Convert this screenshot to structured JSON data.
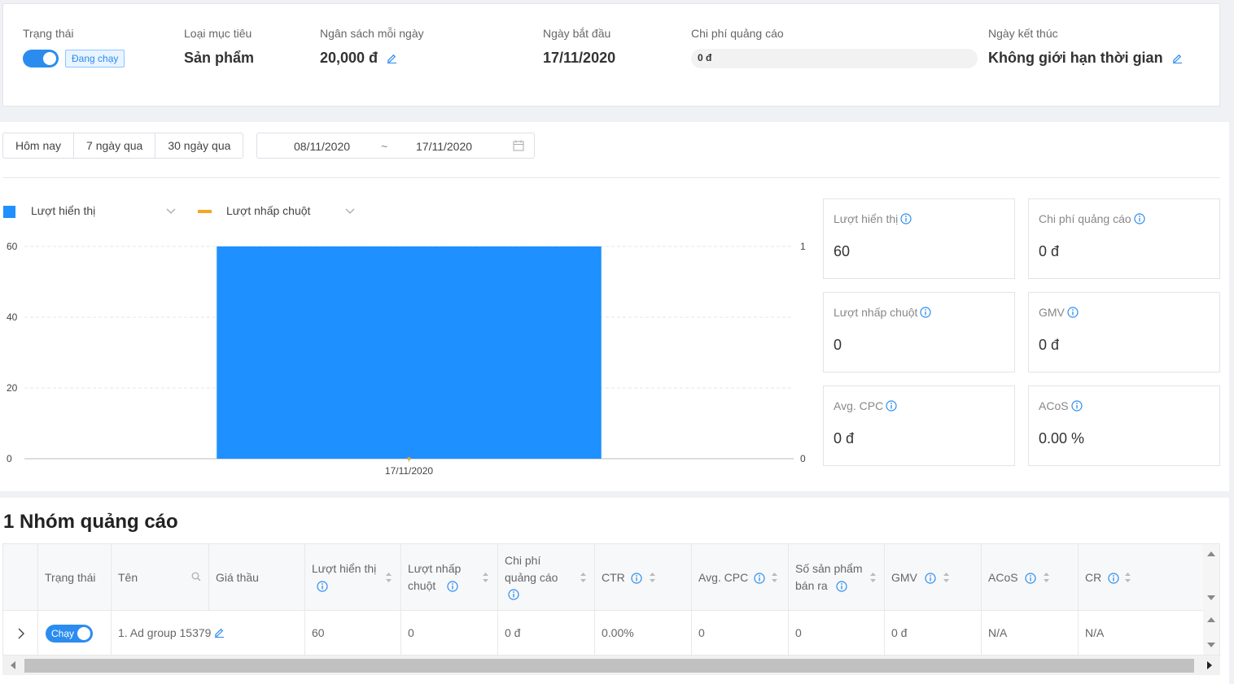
{
  "summary": {
    "status_label": "Trạng thái",
    "status_tag": "Đang chạy",
    "goal_label": "Loại mục tiêu",
    "goal_value": "Sản phẩm",
    "budget_label": "Ngân sách mỗi ngày",
    "budget_value": "20,000 đ",
    "start_label": "Ngày bắt đầu",
    "start_value": "17/11/2020",
    "spend_label": "Chi phí quảng cáo",
    "spend_value": "0 đ",
    "end_label": "Ngày kết thúc",
    "end_value": "Không giới hạn thời gian"
  },
  "filters": {
    "today": "Hôm nay",
    "last7": "7 ngày qua",
    "last30": "30 ngày qua",
    "date_from": "08/11/2020",
    "separator": "~",
    "date_to": "17/11/2020"
  },
  "legend": {
    "impressions": "Lượt hiển thị",
    "clicks": "Lượt nhấp chuột"
  },
  "colors": {
    "accent": "#2b8cf0",
    "bar": "#1e90ff",
    "line": "#f5a623"
  },
  "chart_data": {
    "type": "bar",
    "categories": [
      "17/11/2020"
    ],
    "series": [
      {
        "name": "Lượt hiển thị",
        "values": [
          60
        ],
        "axis": "left"
      },
      {
        "name": "Lượt nhấp chuột",
        "values": [
          0
        ],
        "axis": "right"
      }
    ],
    "ylim": [
      0,
      60
    ],
    "yticks": [
      "0",
      "20",
      "40",
      "60"
    ],
    "y2lim": [
      0,
      1
    ],
    "y2ticks": [
      "0",
      "1"
    ],
    "grid": true
  },
  "stats": [
    {
      "label": "Lượt hiển thị",
      "value": "60"
    },
    {
      "label": "Chi phí quảng cáo",
      "value": "0 đ"
    },
    {
      "label": "Lượt nhấp chuột",
      "value": "0"
    },
    {
      "label": "GMV",
      "value": "0 đ"
    },
    {
      "label": "Avg. CPC",
      "value": "0 đ"
    },
    {
      "label": "ACoS",
      "value": "0.00 %"
    }
  ],
  "table": {
    "title": "1 Nhóm quảng cáo",
    "headers": {
      "status": "Trạng thái",
      "name": "Tên",
      "bid": "Giá thầu",
      "impressions_1": "Lượt hiển thị",
      "clicks_1": "Lượt nhấp",
      "clicks_2": "chuột",
      "cost_1": "Chi phí",
      "cost_2": "quảng cáo",
      "ctr": "CTR",
      "cpc": "Avg. CPC",
      "sold_1": "Số sản phẩm",
      "sold_2": "bán ra",
      "gmv": "GMV",
      "acos": "ACoS",
      "cr": "CR"
    },
    "row": {
      "toggle": "Chạy",
      "name": "1.  Ad group 15379",
      "bid": "",
      "impressions": "60",
      "clicks": "0",
      "cost": "0 đ",
      "ctr": "0.00%",
      "cpc": "0",
      "sold": "0",
      "gmv": "0 đ",
      "acos": "N/A",
      "cr": "N/A"
    }
  }
}
